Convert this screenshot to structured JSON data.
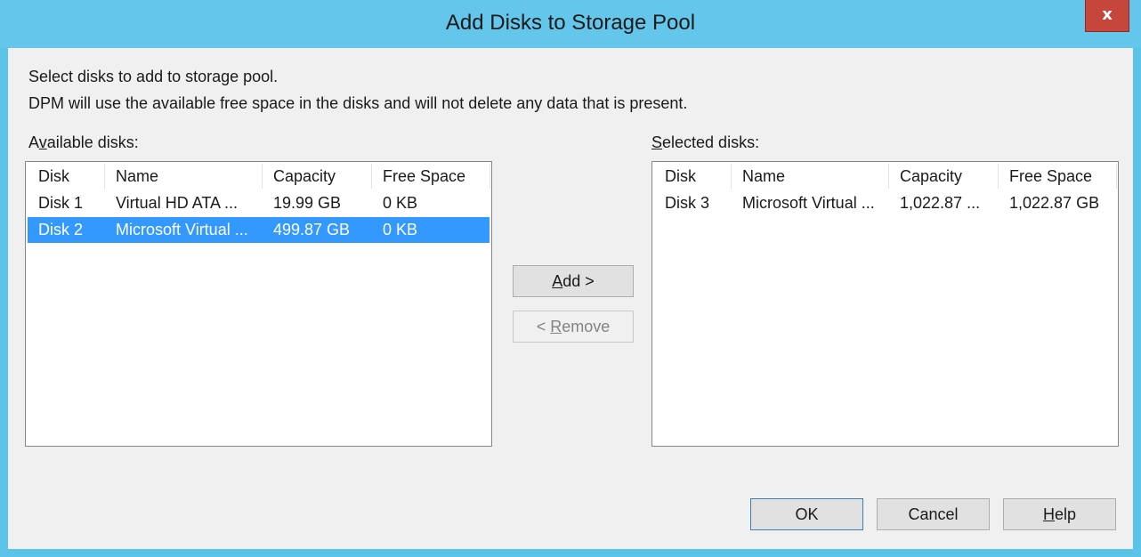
{
  "window": {
    "title": "Add Disks to Storage Pool",
    "close_label": "x"
  },
  "instructions": {
    "line1": "Select disks to add to storage pool.",
    "line2": "DPM will use the available free space in the disks and will not delete any data that is present."
  },
  "available": {
    "label_prefix": "A",
    "label_accel": "v",
    "label_rest": "ailable disks:",
    "columns": [
      "Disk",
      "Name",
      "Capacity",
      "Free Space"
    ],
    "rows": [
      {
        "disk": "Disk 1",
        "name": "Virtual HD ATA ...",
        "capacity": "19.99 GB",
        "free": "0 KB",
        "selected": false
      },
      {
        "disk": "Disk 2",
        "name": "Microsoft Virtual ...",
        "capacity": "499.87 GB",
        "free": "0 KB",
        "selected": true
      }
    ]
  },
  "selected": {
    "label_accel": "S",
    "label_rest": "elected disks:",
    "columns": [
      "Disk",
      "Name",
      "Capacity",
      "Free Space"
    ],
    "rows": [
      {
        "disk": "Disk 3",
        "name": "Microsoft Virtual ...",
        "capacity": "1,022.87 ...",
        "free": "1,022.87 GB"
      }
    ]
  },
  "buttons": {
    "add_accel": "A",
    "add_rest": "dd >",
    "remove_prefix": "< ",
    "remove_accel": "R",
    "remove_rest": "emove",
    "ok": "OK",
    "cancel": "Cancel",
    "help_accel": "H",
    "help_rest": "elp"
  },
  "colors": {
    "titlebar": "#63c6ea",
    "selection": "#3399ff",
    "close": "#c7463c"
  }
}
